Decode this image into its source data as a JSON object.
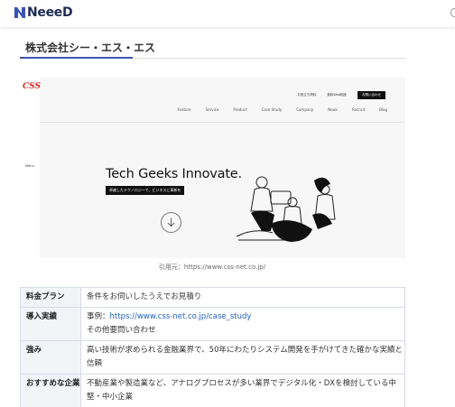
{
  "header": {
    "brand": "NeeeD"
  },
  "page": {
    "company_heading": "株式会社シー・エス・エス"
  },
  "website_screenshot": {
    "logo_text": "CSS",
    "menu_label": "Menu",
    "top_links": [
      "お役立ち資料",
      "無料Web相談"
    ],
    "contact_button": "お問い合わせ",
    "nav_items": [
      "Feature",
      "Service",
      "Product",
      "Case Study",
      "Company",
      "News",
      "Recruit",
      "Blog"
    ],
    "hero_title": "Tech Geeks Innovate.",
    "hero_tagline": "卓越したテクノロジーで、ビジネスに革新を"
  },
  "caption": "引用元：https://www.css-net.co.jp/",
  "details": {
    "rows": [
      {
        "label": "料金プラン",
        "value": "条件をお伺いしたうえでお見積り"
      },
      {
        "label": "導入実績",
        "value_prefix": "事例：",
        "value_link": "https://www.css-net.co.jp/case_study",
        "value_line2": "その他要問い合わせ"
      },
      {
        "label": "強み",
        "value": "高い技術が求められる金融業界で、50年にわたりシステム開発を手がけてきた確かな実績と信頼"
      },
      {
        "label": "おすすめな企業",
        "value": "不動産業や製造業など、アナログプロセスが多い業界でデジタル化・DXを検討している中堅・中小企業"
      }
    ]
  },
  "colors": {
    "brand": "#1f2a55",
    "accent_underline": "#3d53b3",
    "link": "#2262c7",
    "table_label_bg": "#f3f4f8"
  }
}
